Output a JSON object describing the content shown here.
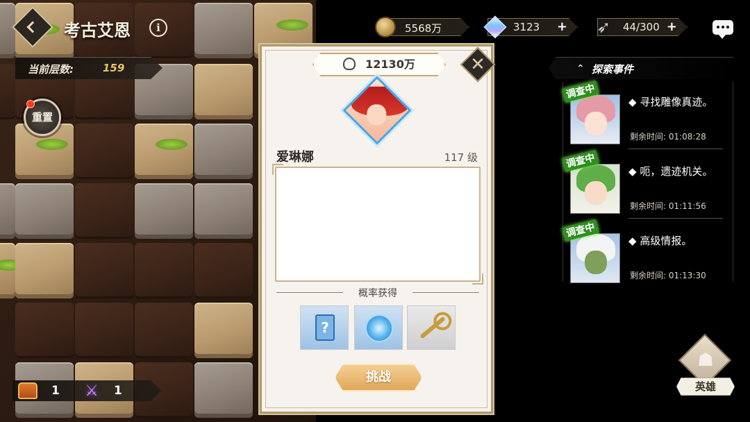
{
  "header": {
    "title": "考古艾恩",
    "floor_label": "当前层数:",
    "floor_value": "159"
  },
  "reset": {
    "label": "重置"
  },
  "counters": {
    "chest_count": "1",
    "swords_count": "1"
  },
  "resources": {
    "gold": "5568万",
    "gems": "3123",
    "stamina": "44/300"
  },
  "card": {
    "power": "12130万",
    "hero_name": "爱琳娜",
    "hero_level": "117 级",
    "chance_label": "概率获得",
    "rewards": [
      "scroll-icon",
      "orb-icon",
      "key-icon"
    ],
    "challenge_label": "挑战"
  },
  "events": {
    "title": "探索事件",
    "items": [
      {
        "tag": "调查中",
        "text": "寻找雕像真迹。",
        "time": "剩余时间: 01:08:28"
      },
      {
        "tag": "调查中",
        "text": "呃，遗迹机关。",
        "time": "剩余时间: 01:11:56"
      },
      {
        "tag": "调查中",
        "text": "高级情报。",
        "time": "剩余时间: 01:13:30"
      }
    ]
  },
  "hero_button": {
    "label": "英雄"
  },
  "colors": {
    "accent_gold": "#c6a871",
    "tag_green": "#2e8f1f",
    "challenge_orange": "#e1a85b"
  }
}
